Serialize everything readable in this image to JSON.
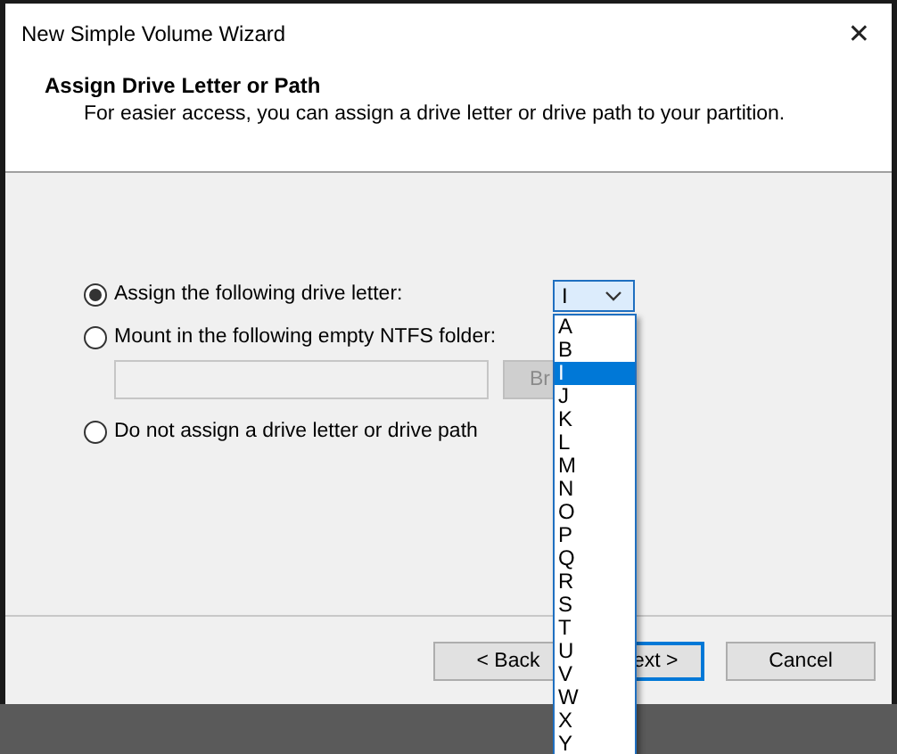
{
  "window": {
    "title": "New Simple Volume Wizard",
    "close": "✕"
  },
  "header": {
    "title": "Assign Drive Letter or Path",
    "subtitle": "For easier access, you can assign a drive letter or drive path to your partition."
  },
  "options": [
    {
      "label": "Assign the following drive letter:",
      "selected": true
    },
    {
      "label": "Mount in the following empty NTFS folder:",
      "selected": false
    },
    {
      "label": "Do not assign a drive letter or drive path",
      "selected": false
    }
  ],
  "drive_combo": {
    "value": "I",
    "expanded": true,
    "items": [
      {
        "label": "A",
        "selected": false
      },
      {
        "label": "B",
        "selected": false
      },
      {
        "label": "I",
        "selected": true
      },
      {
        "label": "J",
        "selected": false
      },
      {
        "label": "K",
        "selected": false
      },
      {
        "label": "L",
        "selected": false
      },
      {
        "label": "M",
        "selected": false
      },
      {
        "label": "N",
        "selected": false
      },
      {
        "label": "O",
        "selected": false
      },
      {
        "label": "P",
        "selected": false
      },
      {
        "label": "Q",
        "selected": false
      },
      {
        "label": "R",
        "selected": false
      },
      {
        "label": "S",
        "selected": false
      },
      {
        "label": "T",
        "selected": false
      },
      {
        "label": "U",
        "selected": false
      },
      {
        "label": "V",
        "selected": false
      },
      {
        "label": "W",
        "selected": false
      },
      {
        "label": "X",
        "selected": false
      },
      {
        "label": "Y",
        "selected": false
      }
    ]
  },
  "browse_button": {
    "label": "Br",
    "disabled": true
  },
  "buttons": [
    {
      "label": "< Back",
      "default": false,
      "covered": false
    },
    {
      "label": "ext >",
      "default": true,
      "covered": true
    },
    {
      "label": "Cancel",
      "default": false,
      "covered": false
    }
  ]
}
